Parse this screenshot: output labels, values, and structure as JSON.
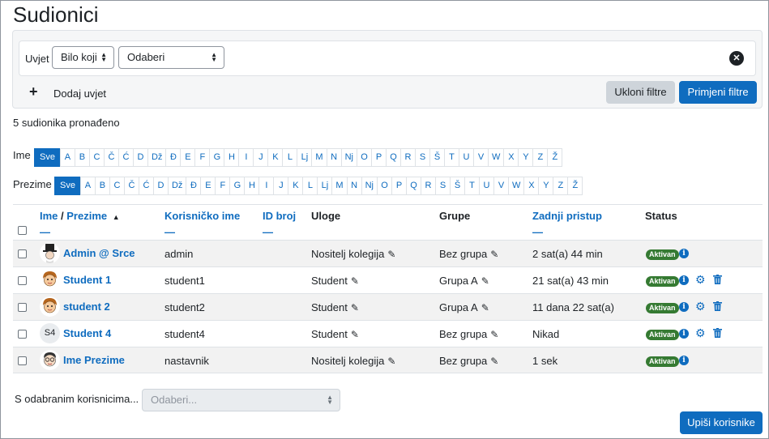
{
  "page": {
    "title": "Sudionici"
  },
  "filter": {
    "condition_label": "Uvjet",
    "match_select": "Bilo koji",
    "type_select": "Odaberi",
    "add_condition": "Dodaj uvjet",
    "clear_button": "Ukloni filtre",
    "apply_button": "Primjeni filtre"
  },
  "count_text": "5 sudionika pronađeno",
  "initials": {
    "first_label": "Ime",
    "last_label": "Prezime",
    "letters": [
      "Sve",
      "A",
      "B",
      "C",
      "Č",
      "Ć",
      "D",
      "Dž",
      "Đ",
      "E",
      "F",
      "G",
      "H",
      "I",
      "J",
      "K",
      "L",
      "Lj",
      "M",
      "N",
      "Nj",
      "O",
      "P",
      "Q",
      "R",
      "S",
      "Š",
      "T",
      "U",
      "V",
      "W",
      "X",
      "Y",
      "Z",
      "Ž"
    ]
  },
  "table": {
    "headers": {
      "first": "Ime",
      "sep": " / ",
      "last": "Prezime",
      "sort_arrow": "▲",
      "username": "Korisničko ime",
      "idnumber": "ID broj",
      "roles": "Uloge",
      "groups": "Grupe",
      "lastaccess": "Zadnji pristup",
      "status": "Status",
      "dash": "—"
    },
    "rows": [
      {
        "name": "Admin @ Srce",
        "username": "admin",
        "role": "Nositelj kolegija",
        "group": "Bez grupa",
        "lastaccess": "2 sat(a) 44 min",
        "status": "Aktivan",
        "avatar": "top-hat-avatar",
        "initials": ""
      },
      {
        "name": "Student 1",
        "username": "student1",
        "role": "Student",
        "group": "Grupa A",
        "lastaccess": "21 sat(a) 43 min",
        "status": "Aktivan",
        "avatar": "student-avatar",
        "initials": ""
      },
      {
        "name": "student 2",
        "username": "student2",
        "role": "Student",
        "group": "Grupa A",
        "lastaccess": "11 dana 22 sat(a)",
        "status": "Aktivan",
        "avatar": "student-avatar",
        "initials": ""
      },
      {
        "name": "Student 4",
        "username": "student4",
        "role": "Student",
        "group": "Bez grupa",
        "lastaccess": "Nikad",
        "status": "Aktivan",
        "avatar": "initials-avatar",
        "initials": "S4"
      },
      {
        "name": "Ime Prezime",
        "username": "nastavnik",
        "role": "Nositelj kolegija",
        "group": "Bez grupa",
        "lastaccess": "1 sek",
        "status": "Aktivan",
        "avatar": "glasses-avatar",
        "initials": ""
      }
    ]
  },
  "bulk": {
    "label": "S odabranim korisnicima...",
    "select": "Odaberi..."
  },
  "enrol_button": "Upiši korisnike",
  "colors": {
    "primary": "#0f6cbf",
    "success": "#357a32",
    "stripe": "#f2f2f2"
  }
}
